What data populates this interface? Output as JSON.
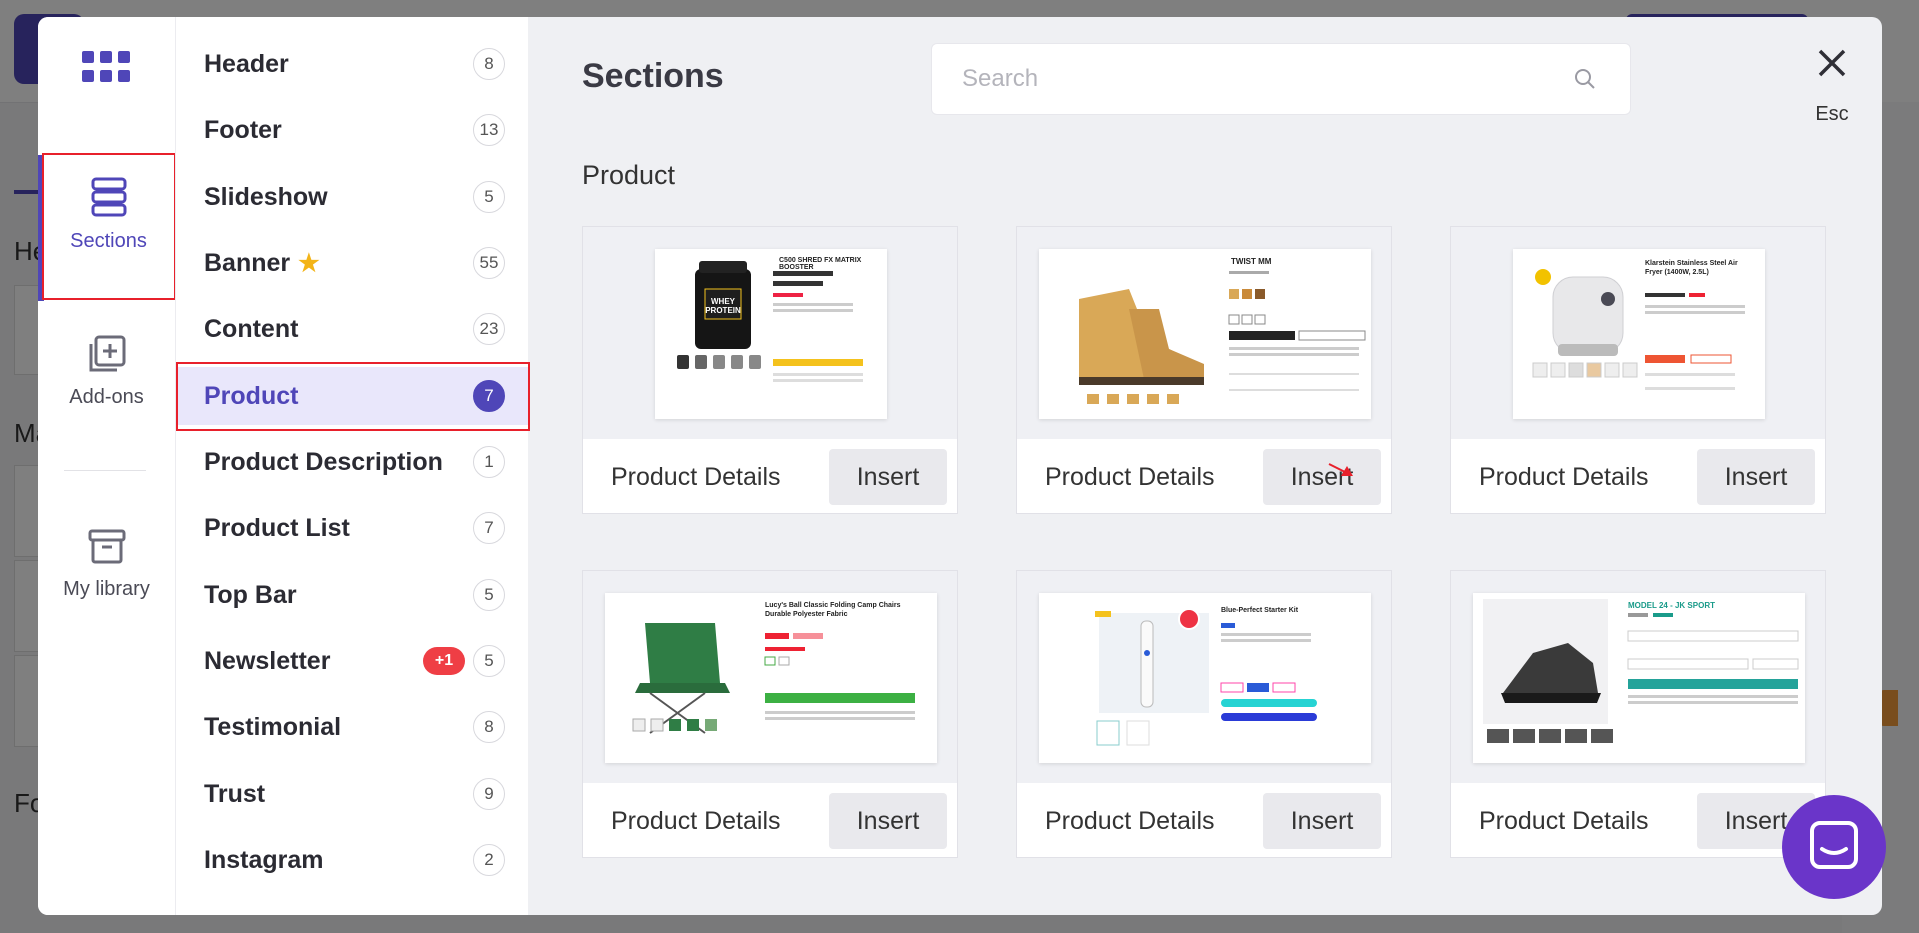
{
  "background": {
    "partial_labels": [
      "He",
      "Ma",
      "Fo"
    ]
  },
  "rail": {
    "items": [
      {
        "label": "Sections",
        "icon": "sections-icon"
      },
      {
        "label": "Add-ons",
        "icon": "add-ons-icon"
      },
      {
        "label": "My library",
        "icon": "library-icon"
      }
    ]
  },
  "categories": [
    {
      "name": "Header",
      "count": "8"
    },
    {
      "name": "Footer",
      "count": "13"
    },
    {
      "name": "Slideshow",
      "count": "5"
    },
    {
      "name": "Banner",
      "count": "55"
    },
    {
      "name": "Content",
      "count": "23"
    },
    {
      "name": "Product",
      "count": "7"
    },
    {
      "name": "Product Description",
      "count": "1"
    },
    {
      "name": "Product List",
      "count": "7"
    },
    {
      "name": "Top Bar",
      "count": "5"
    },
    {
      "name": "Newsletter",
      "count": "5",
      "badge": "+1"
    },
    {
      "name": "Testimonial",
      "count": "8"
    },
    {
      "name": "Trust",
      "count": "9"
    },
    {
      "name": "Instagram",
      "count": "2"
    }
  ],
  "main": {
    "title": "Sections",
    "search_placeholder": "Search",
    "close_hint": "Esc",
    "group_title": "Product"
  },
  "cards": [
    {
      "title": "Product Details",
      "insert_label": "Insert",
      "preview_title": "C500 SHRED FX MATRIX BOOSTER",
      "preview_badge": "WHEY PROTEIN"
    },
    {
      "title": "Product Details",
      "insert_label": "Insert",
      "preview_title": "TWIST MM",
      "preview_badge": ""
    },
    {
      "title": "Product Details",
      "insert_label": "Insert",
      "preview_title": "Klarstein Stainless Steel Air Fryer (1400W, 2.5L)",
      "preview_badge": ""
    },
    {
      "title": "Product Details",
      "insert_label": "Insert",
      "preview_title": "Lucy's Ball Classic Folding Camp Chairs Durable Polyester Fabric",
      "preview_badge": ""
    },
    {
      "title": "Product Details",
      "insert_label": "Insert",
      "preview_title": "Blue-Perfect Starter Kit",
      "preview_badge": ""
    },
    {
      "title": "Product Details",
      "insert_label": "Insert",
      "preview_title": "MODEL 24 - JK SPORT",
      "preview_badge": ""
    }
  ],
  "colors": {
    "accent": "#4f46b8",
    "highlight": "#e8202b",
    "chat": "#6a35c9",
    "star": "#f3b418",
    "badge": "#ef3e45"
  }
}
